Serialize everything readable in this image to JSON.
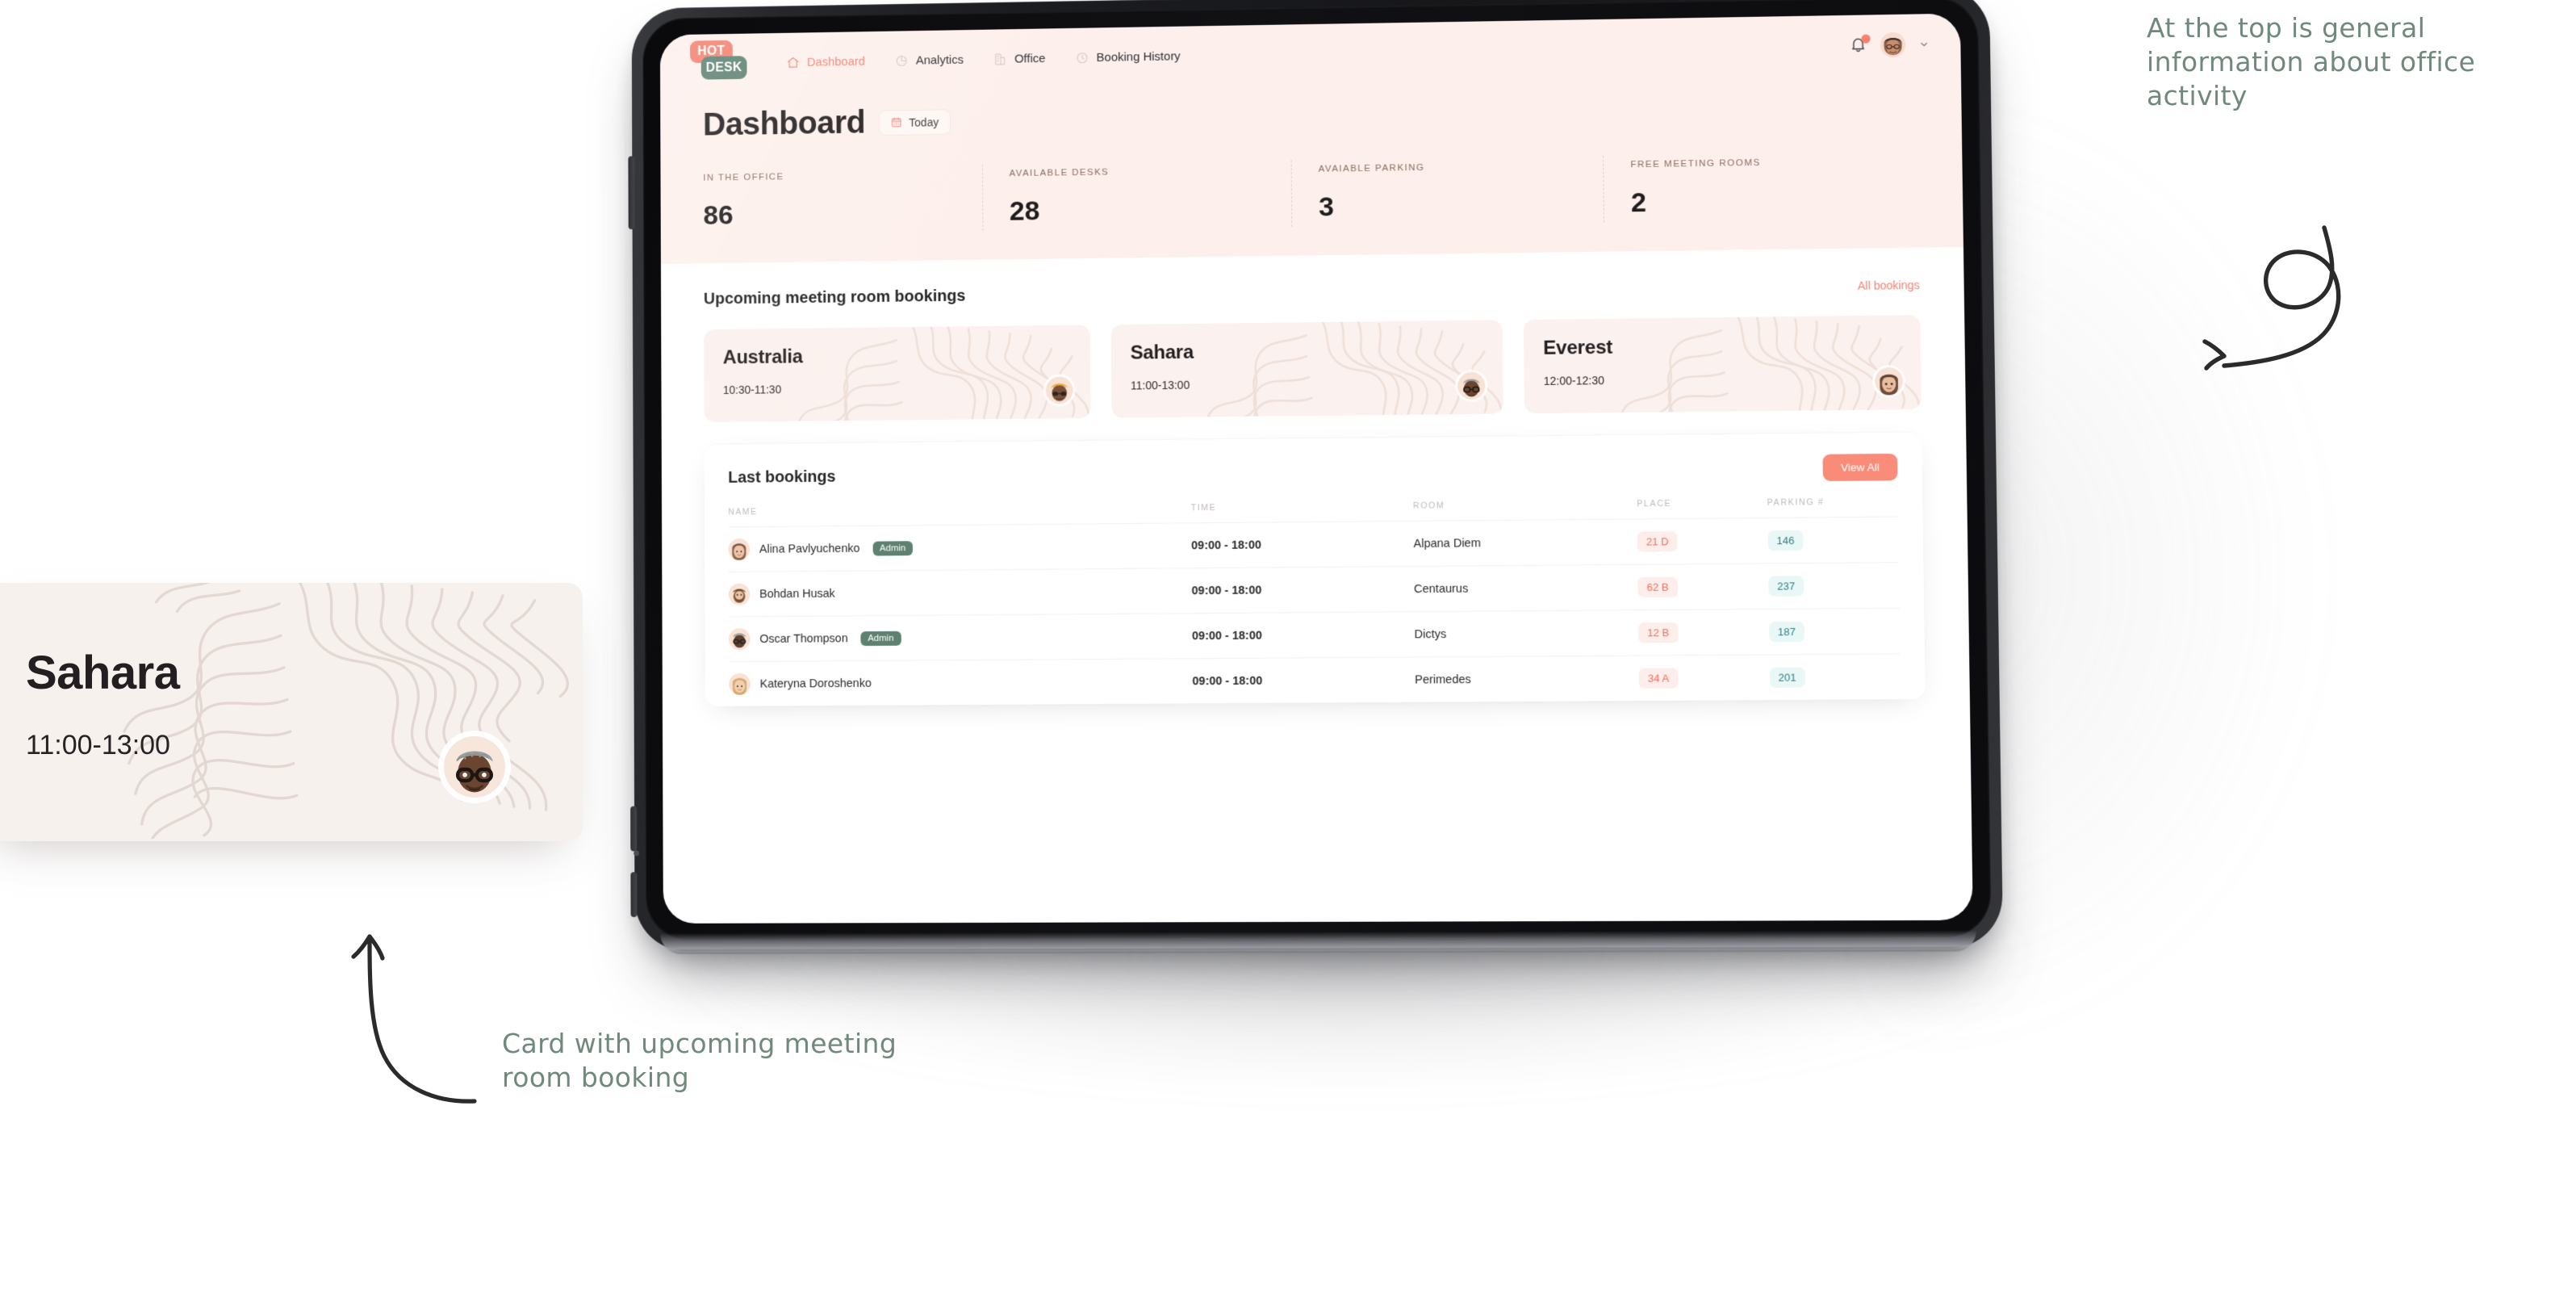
{
  "app": {
    "logo_top": "HOT",
    "logo_bottom": "DESK"
  },
  "nav": {
    "items": [
      {
        "label": "Dashboard",
        "icon": "home-icon",
        "active": true
      },
      {
        "label": "Analytics",
        "icon": "pie-chart-icon",
        "active": false
      },
      {
        "label": "Office",
        "icon": "building-icon",
        "active": false
      },
      {
        "label": "Booking History",
        "icon": "clock-icon",
        "active": false
      }
    ],
    "notification_icon": "bell-icon",
    "has_notification": true,
    "avatar_icon": "user-avatar",
    "chevron_icon": "chevron-down-icon"
  },
  "hero": {
    "title": "Dashboard",
    "date_filter": {
      "label": "Today",
      "icon": "calendar-icon"
    },
    "stats": [
      {
        "label": "IN THE OFFICE",
        "value": "86"
      },
      {
        "label": "AVAILABLE DESKS",
        "value": "28"
      },
      {
        "label": "AVAIABLE PARKING",
        "value": "3"
      },
      {
        "label": "FREE MEETING ROOMS",
        "value": "2"
      }
    ]
  },
  "upcoming": {
    "title": "Upcoming meeting room bookings",
    "all_link": "All bookings",
    "cards": [
      {
        "room": "Australia",
        "time": "10:30-11:30"
      },
      {
        "room": "Sahara",
        "time": "11:00-13:00"
      },
      {
        "room": "Everest",
        "time": "12:00-12:30"
      }
    ]
  },
  "last_bookings": {
    "title": "Last bookings",
    "view_all": "View All",
    "columns": [
      "NAME",
      "TIME",
      "ROOM",
      "PLACE",
      "PARKING #"
    ],
    "rows": [
      {
        "name": "Alina Pavlyuchenko",
        "badge": "Admin",
        "time": "09:00 - 18:00",
        "room": "Alpana Diem",
        "place": "21 D",
        "parking": "146"
      },
      {
        "name": "Bohdan Husak",
        "badge": "",
        "time": "09:00 - 18:00",
        "room": "Centaurus",
        "place": "62 B",
        "parking": "237"
      },
      {
        "name": "Oscar Thompson",
        "badge": "Admin",
        "time": "09:00 - 18:00",
        "room": "Dictys",
        "place": "12 B",
        "parking": "187"
      },
      {
        "name": "Kateryna Doroshenko",
        "badge": "",
        "time": "09:00 - 18:00",
        "room": "Perimedes",
        "place": "34 A",
        "parking": "201"
      }
    ]
  },
  "zoom_card": {
    "room": "Sahara",
    "time": "11:00-13:00"
  },
  "annotations": {
    "top": "At the top is general information about office activity",
    "bottom": "Card with upcoming meeting room booking"
  },
  "colors": {
    "coral": "#f4806f",
    "coral_button": "#f98a76",
    "green": "#5d8272",
    "hero_bg": "#fdf0ec",
    "place_text": "#f2705c",
    "parking_text": "#2b7f82",
    "note_text": "#6f8a7c"
  }
}
